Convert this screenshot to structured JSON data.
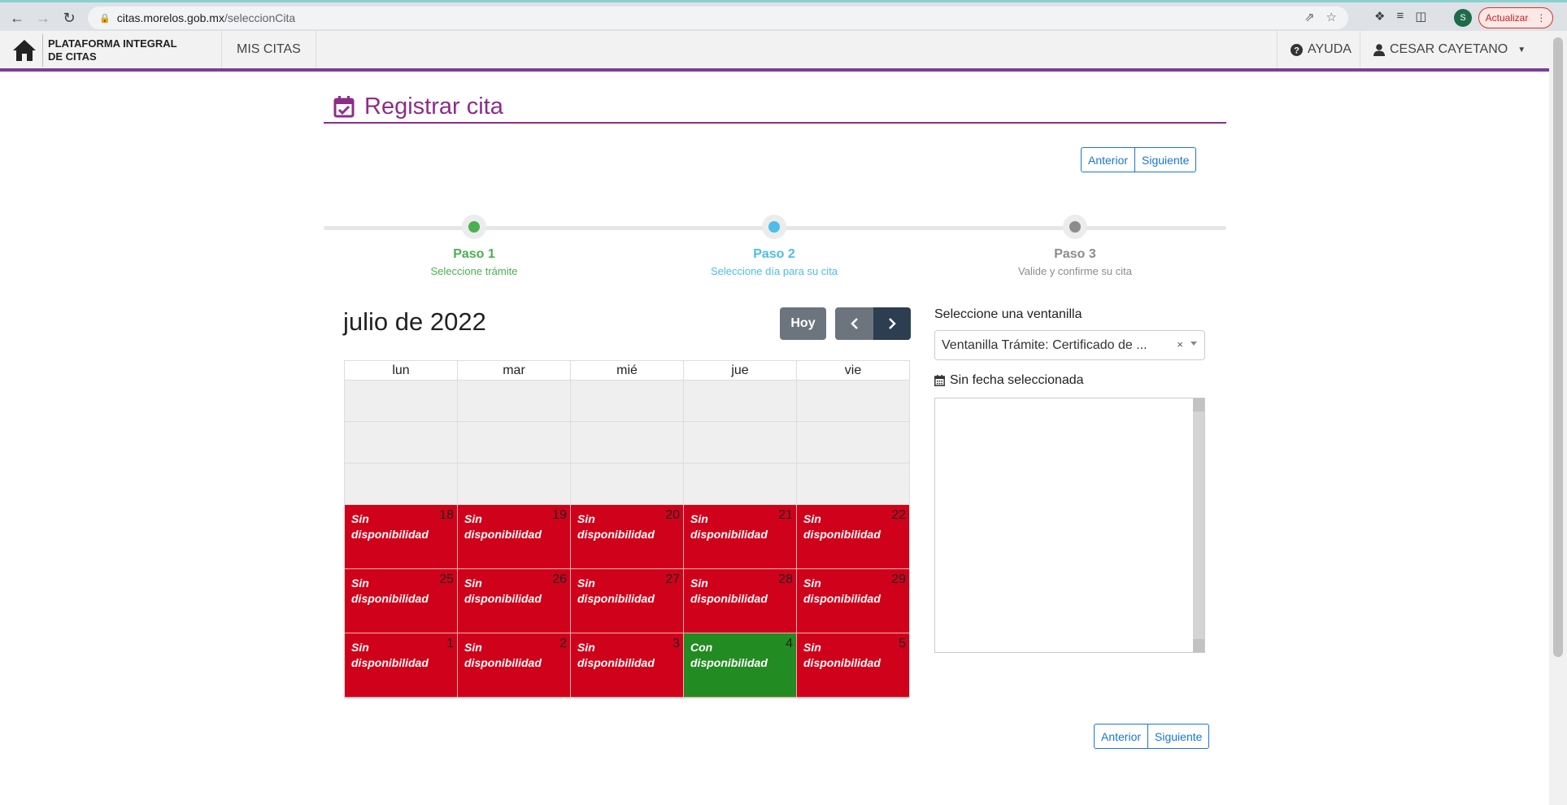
{
  "browser": {
    "url_host": "citas.morelos.gob.mx",
    "url_path": "/seleccionCita",
    "profile_initial": "S",
    "update_label": "Actualizar"
  },
  "header": {
    "brand_line1": "PLATAFORMA INTEGRAL",
    "brand_line2": "DE CITAS",
    "nav_mis_citas": "MIS CITAS",
    "nav_help": "AYUDA",
    "nav_user": "CESAR CAYETANO"
  },
  "page": {
    "title": "Registrar cita",
    "prev_label": "Anterior",
    "next_label": "Siguiente"
  },
  "steps": [
    {
      "label": "Paso 1",
      "sub": "Seleccione trámite",
      "color": "#4caf50"
    },
    {
      "label": "Paso 2",
      "sub": "Seleccione día para su cita",
      "color": "#4dbde8"
    },
    {
      "label": "Paso 3",
      "sub": "Valide y confirme su cita",
      "color": "#8c8c8c"
    }
  ],
  "calendar": {
    "title": "julio de 2022",
    "today_label": "Hoy",
    "weekdays": [
      "lun",
      "mar",
      "mié",
      "jue",
      "vie"
    ],
    "colors": {
      "sin": "#d0021b",
      "con": "#228b22"
    },
    "weeks": [
      [
        {
          "num": "18",
          "status": "sin",
          "line1": "Sin",
          "line2": "disponibilidad"
        },
        {
          "num": "19",
          "status": "sin",
          "line1": "Sin",
          "line2": "disponibilidad"
        },
        {
          "num": "20",
          "status": "sin",
          "line1": "Sin",
          "line2": "disponibilidad"
        },
        {
          "num": "21",
          "status": "sin",
          "line1": "Sin",
          "line2": "disponibilidad"
        },
        {
          "num": "22",
          "status": "sin",
          "line1": "Sin",
          "line2": "disponibilidad"
        }
      ],
      [
        {
          "num": "25",
          "status": "sin",
          "line1": "Sin",
          "line2": "disponibilidad"
        },
        {
          "num": "26",
          "status": "sin",
          "line1": "Sin",
          "line2": "disponibilidad"
        },
        {
          "num": "27",
          "status": "sin",
          "line1": "Sin",
          "line2": "disponibilidad"
        },
        {
          "num": "28",
          "status": "sin",
          "line1": "Sin",
          "line2": "disponibilidad"
        },
        {
          "num": "29",
          "status": "sin",
          "line1": "Sin",
          "line2": "disponibilidad"
        }
      ],
      [
        {
          "num": "1",
          "status": "sin",
          "line1": "Sin",
          "line2": "disponibilidad"
        },
        {
          "num": "2",
          "status": "sin",
          "line1": "Sin",
          "line2": "disponibilidad"
        },
        {
          "num": "3",
          "status": "sin",
          "line1": "Sin",
          "line2": "disponibilidad"
        },
        {
          "num": "4",
          "status": "con",
          "line1": "Con",
          "line2": "disponibilidad"
        },
        {
          "num": "5",
          "status": "sin",
          "line1": "Sin",
          "line2": "disponibilidad"
        }
      ]
    ]
  },
  "ventanilla": {
    "label": "Seleccione una ventanilla",
    "selected": "Ventanilla Trámite: Certificado de ...",
    "clear": "×",
    "date_label": "Sin fecha seleccionada"
  }
}
